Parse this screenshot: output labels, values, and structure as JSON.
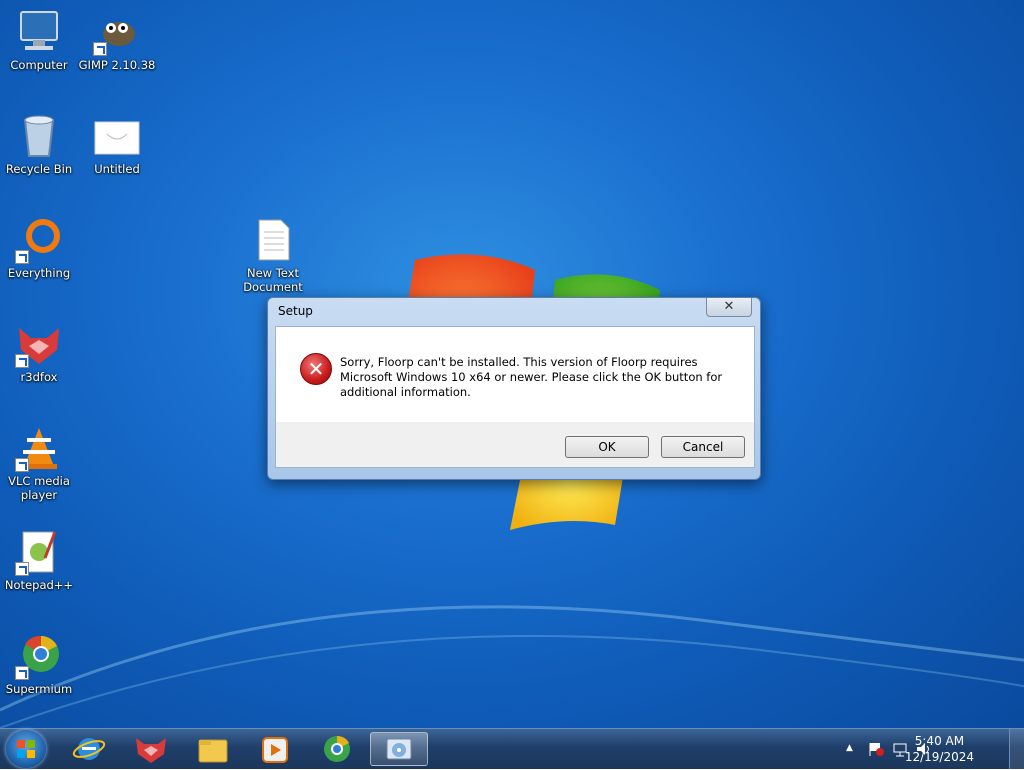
{
  "desktop_icons": [
    {
      "label": "Computer"
    },
    {
      "label": "GIMP 2.10.38"
    },
    {
      "label": "Recycle Bin"
    },
    {
      "label": "Untitled"
    },
    {
      "label": "Everything"
    },
    {
      "label": "New Text Document"
    },
    {
      "label": "r3dfox"
    },
    {
      "label": "VLC media player"
    },
    {
      "label": "Notepad++"
    },
    {
      "label": "Supermium"
    }
  ],
  "dialog": {
    "title": "Setup",
    "close_symbol": "✕",
    "icon": "error-icon",
    "message": "Sorry, Floorp can't be installed. This version of Floorp requires Microsoft Windows 10 x64 or newer. Please click the OK button for additional information.",
    "ok_label": "OK",
    "cancel_label": "Cancel"
  },
  "taskbar": {
    "items": [
      "internet-explorer-icon",
      "r3dfox-icon",
      "file-explorer-icon",
      "media-player-icon",
      "supermium-icon",
      "setup-installer-icon"
    ],
    "clock_time": "5:40 AM",
    "clock_date": "12/19/2024",
    "tray_arrow": "▲"
  }
}
